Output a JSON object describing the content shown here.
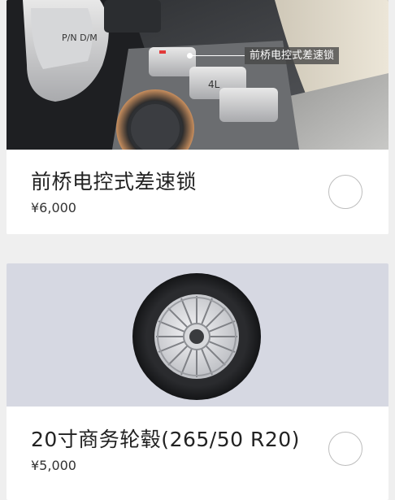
{
  "options": [
    {
      "title": "前桥电控式差速锁",
      "price": "¥6,000",
      "image_callout": "前桥电控式差速锁",
      "image_labels": {
        "gear": "P/N D/M",
        "drive_mode": "4L"
      }
    },
    {
      "title": "20寸商务轮毂(265/50 R20)",
      "price": "¥5,000"
    }
  ],
  "colors": {
    "page_background": "#efefef",
    "card_background": "#ffffff",
    "wheel_image_background": "#d6d8e2",
    "radio_border": "#bdbdbd"
  },
  "icons": [
    "radio-unselected-icon",
    "radio-unselected-icon"
  ]
}
